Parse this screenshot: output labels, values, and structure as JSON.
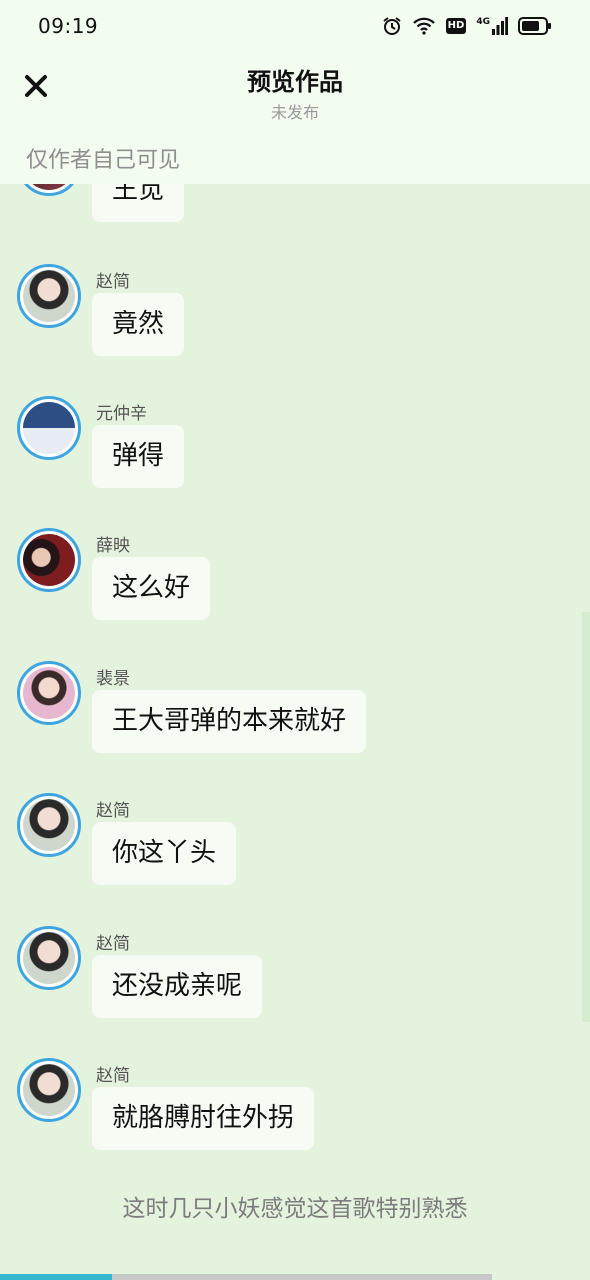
{
  "status_bar": {
    "time": "09:19",
    "icons": [
      "alarm-icon",
      "wifi-icon",
      "hd-icon",
      "4g-signal-icon",
      "battery-icon"
    ],
    "hd_label": "HD",
    "network_label": "4G"
  },
  "header": {
    "title": "预览作品",
    "subtitle": "未发布",
    "close_icon": "close-icon",
    "visibility_note": "仅作者自己可见"
  },
  "messages": [
    {
      "sender": "",
      "text": "王觅",
      "avatar": "avatar-partial"
    },
    {
      "sender": "赵简",
      "text": "竟然",
      "avatar": "avatar-zhaojian"
    },
    {
      "sender": "元仲辛",
      "text": "弹得",
      "avatar": "avatar-yuanzhongxin"
    },
    {
      "sender": "薛映",
      "text": "这么好",
      "avatar": "avatar-xueying"
    },
    {
      "sender": "裴景",
      "text": "王大哥弹的本来就好",
      "avatar": "avatar-peijing"
    },
    {
      "sender": "赵简",
      "text": "你这丫头",
      "avatar": "avatar-zhaojian"
    },
    {
      "sender": "赵简",
      "text": "还没成亲呢",
      "avatar": "avatar-zhaojian"
    },
    {
      "sender": "赵简",
      "text": "就胳膊肘往外拐",
      "avatar": "avatar-zhaojian"
    }
  ],
  "narration": "这时几只小妖感觉这首歌特别熟悉",
  "colors": {
    "background": "#e4f3dd",
    "header_bg": "#f2fcef",
    "bubble_bg": "#f6fcf4",
    "avatar_ring": "#3ea5e0",
    "progress_active": "#35b8d0",
    "progress_inactive": "#c8c8c8"
  },
  "progress": {
    "filled_fraction": 0.19
  }
}
